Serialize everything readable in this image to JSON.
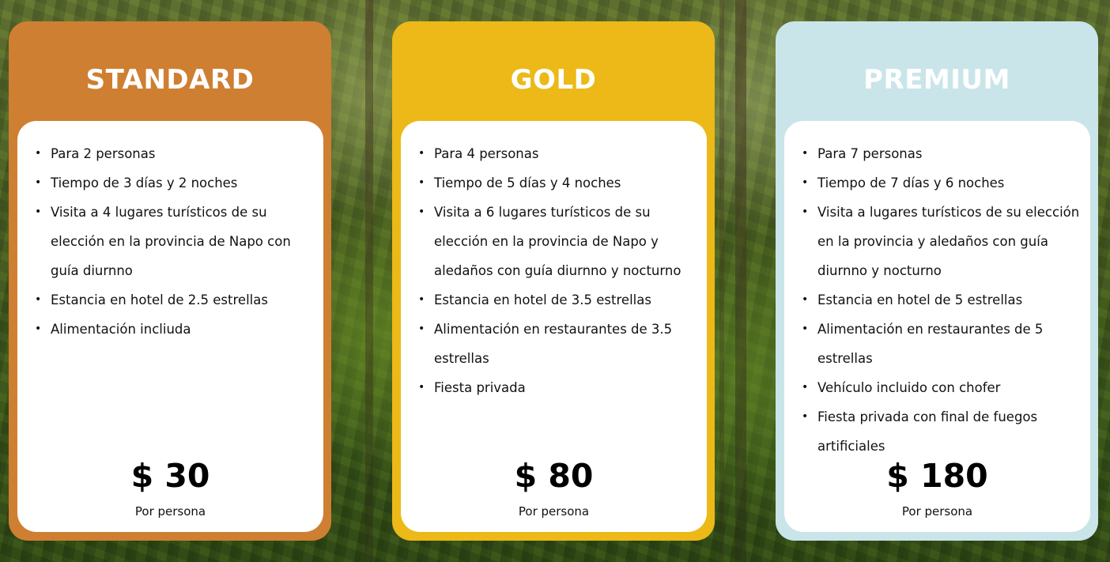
{
  "plans": [
    {
      "title": "STANDARD",
      "features": [
        "Para 2 personas",
        "Tiempo de 3 días y 2 noches",
        "Visita a 4 lugares turísticos de su elección en la provincia de Napo con guía diurnno",
        "Estancia en hotel de 2.5 estrellas",
        "Alimentación incliuda"
      ],
      "price": "$ 30",
      "price_caption": "Por persona",
      "color": "#cf7f31"
    },
    {
      "title": "GOLD",
      "features": [
        "Para 4 personas",
        "Tiempo de 5 días y 4 noches",
        "Visita a 6 lugares turísticos de su elección en la provincia de Napo y aledaños con guía diurnno y nocturno",
        "Estancia en hotel de 3.5 estrellas",
        "Alimentación en restaurantes de 3.5 estrellas",
        "Fiesta privada"
      ],
      "price": "$ 80",
      "price_caption": "Por persona",
      "color": "#ecb918"
    },
    {
      "title": "PREMIUM",
      "features": [
        "Para 7 personas",
        "Tiempo de 7 días y 6 noches",
        "Visita a lugares turísticos de su elección en la provincia y aledaños con guía diurnno y nocturno",
        "Estancia en hotel de 5 estrellas",
        "Alimentación en restaurantes de 5 estrellas",
        "Vehículo incluido con chofer",
        "Fiesta privada con final de fuegos artificiales"
      ],
      "price": "$ 180",
      "price_caption": "Por persona",
      "color": "#c9e5ea"
    }
  ]
}
